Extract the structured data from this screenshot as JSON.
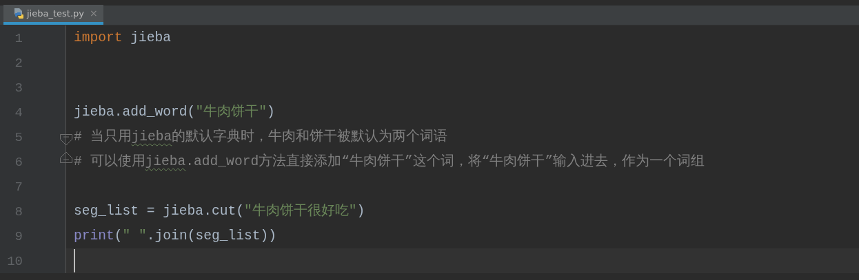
{
  "tabs": [
    {
      "label": "jieba_test.py",
      "selected": true,
      "close": "×"
    }
  ],
  "lines": [
    {
      "number": "1",
      "tokens": [
        {
          "kind": "keyword",
          "text": "import"
        },
        {
          "kind": "plain",
          "text": " jieba"
        }
      ]
    },
    {
      "number": "2"
    },
    {
      "number": "3"
    },
    {
      "number": "4",
      "tokens": [
        {
          "kind": "plain",
          "text": "jieba.add_word("
        },
        {
          "kind": "string",
          "text": "\"牛肉饼干\""
        },
        {
          "kind": "plain",
          "text": ")"
        }
      ]
    },
    {
      "number": "5",
      "fold_start": true,
      "tokens": [
        {
          "kind": "comment",
          "text": "# 当只用"
        },
        {
          "kind": "comment_typo",
          "text": "jieba"
        },
        {
          "kind": "comment",
          "text": "的默认字典时，牛肉和饼干被默认为两个词语"
        }
      ]
    },
    {
      "number": "6",
      "fold_end": true,
      "tokens": [
        {
          "kind": "comment",
          "text": "# 可以使用"
        },
        {
          "kind": "comment_typo",
          "text": "jieba"
        },
        {
          "kind": "comment",
          "text": ".add_word方法直接添加“牛肉饼干”这个词，将“牛肉饼干”输入进去，作为一个词组"
        }
      ]
    },
    {
      "number": "7"
    },
    {
      "number": "8",
      "tokens": [
        {
          "kind": "plain",
          "text": "seg_list = jieba.cut("
        },
        {
          "kind": "string",
          "text": "\"牛肉饼干很好吃\""
        },
        {
          "kind": "plain",
          "text": ")"
        }
      ]
    },
    {
      "number": "9",
      "tokens": [
        {
          "kind": "builtin",
          "text": "print"
        },
        {
          "kind": "plain",
          "text": "("
        },
        {
          "kind": "string",
          "text": "\" \""
        },
        {
          "kind": "plain",
          "text": ".join(seg_list))"
        }
      ]
    },
    {
      "number": "10",
      "current": true,
      "caret": true
    }
  ]
}
